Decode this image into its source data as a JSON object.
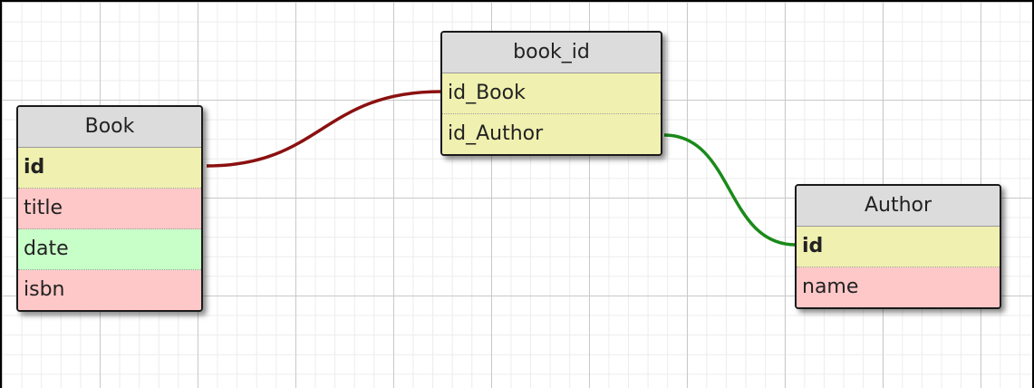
{
  "colors": {
    "key": "#f0f0b0",
    "text_field": "#ffc8c8",
    "date_field": "#c8ffc8",
    "header": "#dcdcdc",
    "link_book": "#8b1010",
    "link_author": "#1a8a1a"
  },
  "tables": {
    "book": {
      "title": "Book",
      "fields": [
        {
          "name": "id",
          "kind": "key"
        },
        {
          "name": "title",
          "kind": "text_field"
        },
        {
          "name": "date",
          "kind": "date_field"
        },
        {
          "name": "isbn",
          "kind": "text_field"
        }
      ]
    },
    "book_id": {
      "title": "book_id",
      "fields": [
        {
          "name": "id_Book",
          "kind": "key"
        },
        {
          "name": "id_Author",
          "kind": "key"
        }
      ]
    },
    "author": {
      "title": "Author",
      "fields": [
        {
          "name": "id",
          "kind": "key"
        },
        {
          "name": "name",
          "kind": "text_field"
        }
      ]
    }
  }
}
